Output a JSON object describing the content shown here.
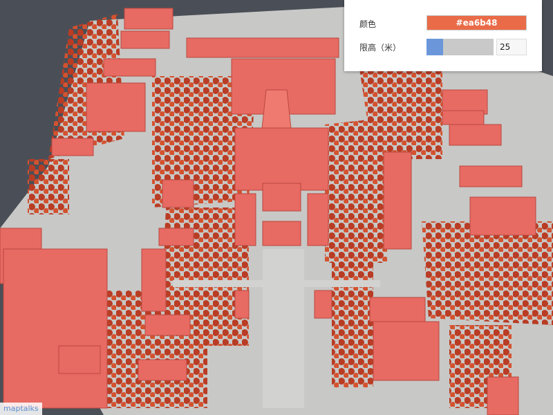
{
  "panel": {
    "color_label": "颜色",
    "color_value": "#ea6b48",
    "height_label": "限高（米）",
    "height_value": "25",
    "height_fraction": 0.25
  },
  "attribution": "maptalks",
  "colors": {
    "building": "#ea6b48",
    "roof": "#e76a63",
    "background": "#4a4f57",
    "slider_fill": "#6b97da",
    "slider_track": "#c9c9c9",
    "ground": "#c8c8c6"
  }
}
